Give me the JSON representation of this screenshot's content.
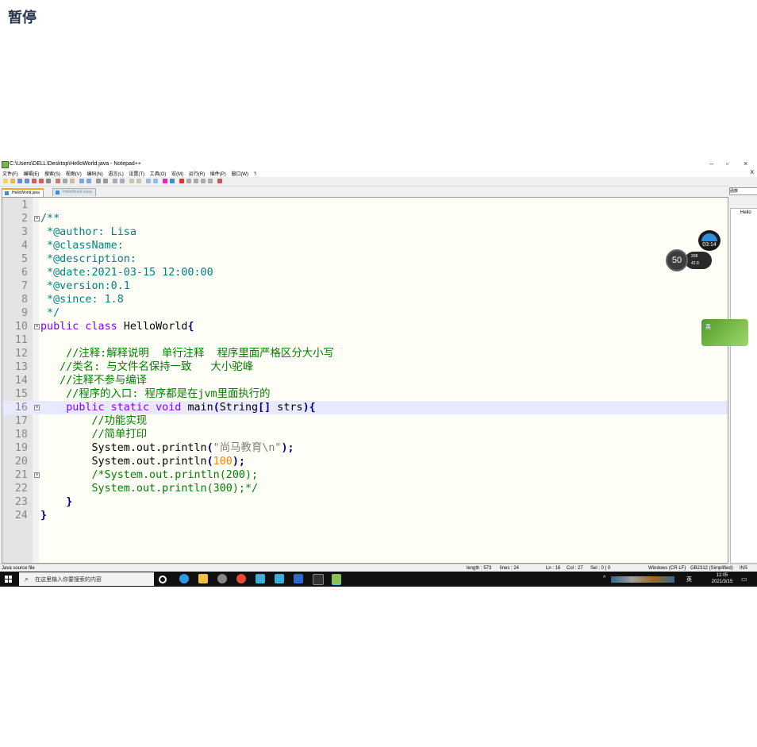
{
  "overlay": {
    "paused_label": "暂停"
  },
  "window": {
    "title": "C:\\Users\\DELL\\Desktop\\HelloWorld.java - Notepad++",
    "controls": {
      "minimize": "–",
      "maximize": "▫",
      "close": "×"
    }
  },
  "menu": {
    "items": [
      "文件(F)",
      "编辑(E)",
      "搜索(S)",
      "视图(V)",
      "编码(N)",
      "语言(L)",
      "设置(T)",
      "工具(O)",
      "宏(M)",
      "运行(R)",
      "插件(P)",
      "窗口(W)",
      "?"
    ],
    "close_doc": "X"
  },
  "tabs": [
    {
      "label": "HelloWorld.java",
      "active": true
    },
    {
      "label": "HelloWorld.class",
      "active": false
    }
  ],
  "editor": {
    "current_line": 16,
    "lines": [
      {
        "n": "1",
        "segs": []
      },
      {
        "n": "2",
        "fold": "⊟",
        "segs": [
          {
            "c": "c-doc",
            "t": "/**"
          }
        ]
      },
      {
        "n": "3",
        "segs": [
          {
            "c": "c-doc",
            "t": " *@author: Lisa"
          }
        ]
      },
      {
        "n": "4",
        "segs": [
          {
            "c": "c-doc",
            "t": " *@className:"
          }
        ]
      },
      {
        "n": "5",
        "segs": [
          {
            "c": "c-doc",
            "t": " *@description:"
          }
        ]
      },
      {
        "n": "6",
        "segs": [
          {
            "c": "c-doc",
            "t": " *@date:2021-03-15 12:00:00"
          }
        ]
      },
      {
        "n": "7",
        "segs": [
          {
            "c": "c-doc",
            "t": " *@version:0.1"
          }
        ]
      },
      {
        "n": "8",
        "segs": [
          {
            "c": "c-doc",
            "t": " *@since: 1.8"
          }
        ]
      },
      {
        "n": "9",
        "segs": [
          {
            "c": "c-doc",
            "t": " */"
          }
        ]
      },
      {
        "n": "10",
        "fold": "⊟",
        "segs": [
          {
            "c": "c-kw",
            "t": "public class "
          },
          {
            "c": "c-plain",
            "t": "HelloWorld"
          },
          {
            "c": "c-op",
            "t": "{"
          }
        ]
      },
      {
        "n": "11",
        "segs": []
      },
      {
        "n": "12",
        "segs": [
          {
            "c": "c-cm",
            "t": "    //注释:解释说明  单行注释  程序里面严格区分大小写"
          }
        ]
      },
      {
        "n": "13",
        "segs": [
          {
            "c": "c-cm",
            "t": "   //类名: 与文件名保持一致   大小驼峰"
          }
        ]
      },
      {
        "n": "14",
        "segs": [
          {
            "c": "c-cm",
            "t": "   //注释不参与编译"
          }
        ]
      },
      {
        "n": "15",
        "segs": [
          {
            "c": "c-cm",
            "t": "    //程序的入口: 程序都是在jvm里面执行的"
          }
        ]
      },
      {
        "n": "16",
        "fold": "⊟",
        "segs": [
          {
            "c": "c-kw",
            "t": "    public static void "
          },
          {
            "c": "c-plain",
            "t": "main"
          },
          {
            "c": "c-op",
            "t": "("
          },
          {
            "c": "c-plain",
            "t": "String"
          },
          {
            "c": "c-op",
            "t": "[]"
          },
          {
            "c": "c-plain",
            "t": " strs"
          },
          {
            "c": "c-op",
            "t": "){"
          }
        ]
      },
      {
        "n": "17",
        "segs": [
          {
            "c": "c-cm",
            "t": "        //功能实现"
          }
        ]
      },
      {
        "n": "18",
        "segs": [
          {
            "c": "c-cm",
            "t": "        //简单打印"
          }
        ]
      },
      {
        "n": "19",
        "segs": [
          {
            "c": "c-plain",
            "t": "        System.out.println"
          },
          {
            "c": "c-op",
            "t": "("
          },
          {
            "c": "c-str",
            "t": "\"尚马教育\\n\""
          },
          {
            "c": "c-op",
            "t": ");"
          }
        ]
      },
      {
        "n": "20",
        "segs": [
          {
            "c": "c-plain",
            "t": "        System.out.println"
          },
          {
            "c": "c-op",
            "t": "("
          },
          {
            "c": "c-num",
            "t": "100"
          },
          {
            "c": "c-op",
            "t": ");"
          }
        ]
      },
      {
        "n": "21",
        "fold": "⊟",
        "segs": [
          {
            "c": "c-cm",
            "t": "        /*System.out.println(200);"
          }
        ]
      },
      {
        "n": "22",
        "segs": [
          {
            "c": "c-cm",
            "t": "        System.out.println(300);*/"
          }
        ]
      },
      {
        "n": "23",
        "segs": [
          {
            "c": "c-op",
            "t": "    }"
          }
        ]
      },
      {
        "n": "24",
        "segs": [
          {
            "c": "c-op",
            "t": "}"
          }
        ]
      }
    ]
  },
  "side_panel": {
    "header": "函数",
    "item": "Hello"
  },
  "status": {
    "file_type": "Java source file",
    "length": "length : 573",
    "lines": "lines : 24",
    "ln": "Ln : 16",
    "col": "Col : 27",
    "sel": "Sel : 0 | 0",
    "eol": "Windows (CR LF)",
    "encoding": "GB2312 (Simplified)",
    "mode": "INS"
  },
  "taskbar": {
    "search_placeholder": "在这里输入你要搜索的内容",
    "ime": "英",
    "time": "11:05",
    "date": "2021/3/15"
  },
  "widgets": {
    "weather_time": "03:14",
    "cpu_percent": "50",
    "net_up": "208",
    "net_down": "42.8",
    "ime_widget": "英"
  },
  "colors": {
    "doc_comment": "#008080",
    "comment": "#008000",
    "keyword": "#8000ff",
    "number": "#ff8000",
    "string": "#808080",
    "operator": "#000080",
    "current_line": "#e8e8ff"
  }
}
